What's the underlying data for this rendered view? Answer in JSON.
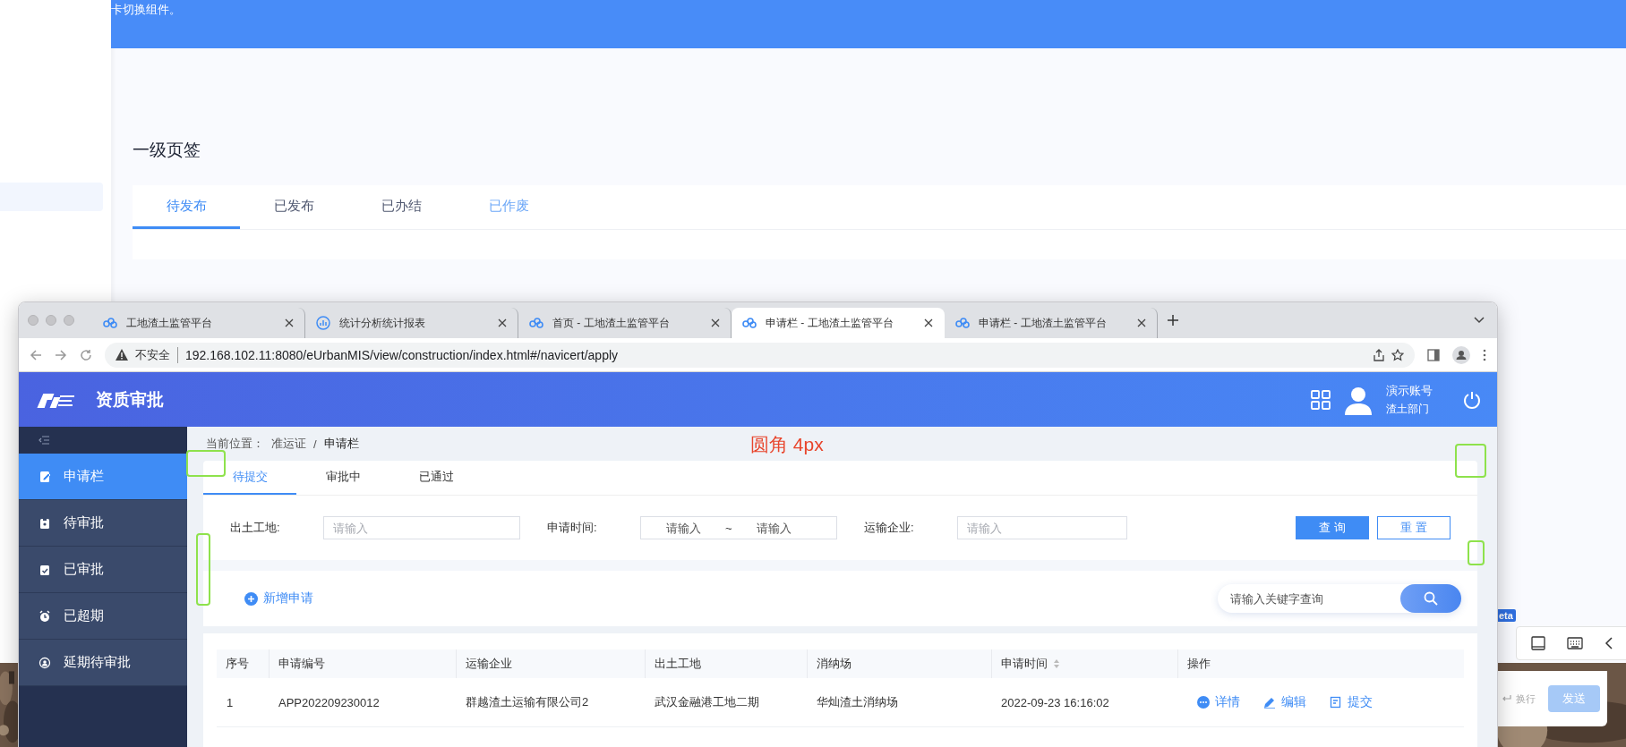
{
  "doc_page": {
    "banner_text": "卡切换组件。",
    "heading": "一级页签",
    "tabs": [
      {
        "label": "待发布",
        "selected": true,
        "hover": false
      },
      {
        "label": "已发布",
        "selected": false,
        "hover": false
      },
      {
        "label": "已办结",
        "selected": false,
        "hover": false
      },
      {
        "label": "已作废",
        "selected": false,
        "hover": true
      }
    ]
  },
  "browser": {
    "tabs": [
      {
        "title": "工地渣土监管平台",
        "kind": "cloud",
        "selected": false
      },
      {
        "title": "统计分析统计报表",
        "kind": "chart",
        "selected": false
      },
      {
        "title": "首页 - 工地渣土监管平台",
        "kind": "cloud",
        "selected": false
      },
      {
        "title": "申请栏 - 工地渣土监管平台",
        "kind": "cloud",
        "selected": true
      },
      {
        "title": "申请栏 - 工地渣土监管平台",
        "kind": "cloud",
        "selected": false
      }
    ],
    "security": "不安全",
    "url": "192.168.102.11:8080/eUrbanMIS/view/construction/index.html#/navicert/apply"
  },
  "app": {
    "title": "资质审批",
    "user": {
      "name": "演示账号",
      "department": "渣土部门"
    },
    "sidebar": [
      {
        "label": "申请栏",
        "kind": "edit",
        "selected": true
      },
      {
        "label": "待审批",
        "kind": "clipboard",
        "selected": false
      },
      {
        "label": "已审批",
        "kind": "check",
        "selected": false
      },
      {
        "label": "已超期",
        "kind": "alarm",
        "selected": false
      },
      {
        "label": "延期待审批",
        "kind": "person",
        "selected": false
      }
    ],
    "breadcrumb": {
      "prefix": "当前位置：",
      "parent": "准运证",
      "separator": "/",
      "current": "申请栏"
    },
    "tabs": [
      {
        "label": "待提交",
        "selected": true
      },
      {
        "label": "审批中",
        "selected": false
      },
      {
        "label": "已通过",
        "selected": false
      }
    ],
    "filters": {
      "site_label": "出土工地:",
      "site_placeholder": "请输入",
      "time_label": "申请时间:",
      "time_start_placeholder": "请输入",
      "time_separator": "~",
      "time_end_placeholder": "请输入",
      "company_label": "运输企业:",
      "company_placeholder": "请输入",
      "query_button": "查 询",
      "reset_button": "重 置"
    },
    "add_button": "新增申请",
    "search_placeholder": "请输入关键字查询",
    "table": {
      "columns": [
        {
          "label": "序号",
          "sortable": false
        },
        {
          "label": "申请编号",
          "sortable": false
        },
        {
          "label": "运输企业",
          "sortable": false
        },
        {
          "label": "出土工地",
          "sortable": false
        },
        {
          "label": "消纳场",
          "sortable": false
        },
        {
          "label": "申请时间",
          "sortable": true
        },
        {
          "label": "操作",
          "sortable": false
        }
      ],
      "rows": [
        {
          "cells": [
            "1",
            "APP202209230012",
            "群越渣土运输有限公司2",
            "武汉金融港工地二期",
            "华灿渣土消纳场",
            "2022-09-23 16:16:02"
          ],
          "actions": [
            {
              "label": "详情",
              "kind": "more"
            },
            {
              "label": "编辑",
              "kind": "pencil"
            },
            {
              "label": "提交",
              "kind": "submit"
            }
          ]
        }
      ]
    }
  },
  "annotation": {
    "note": "圆角 4px"
  },
  "chat_panel": {
    "badge": "eta",
    "newline_hint": "换行",
    "send_button": "发送",
    "send_disabled": true
  }
}
